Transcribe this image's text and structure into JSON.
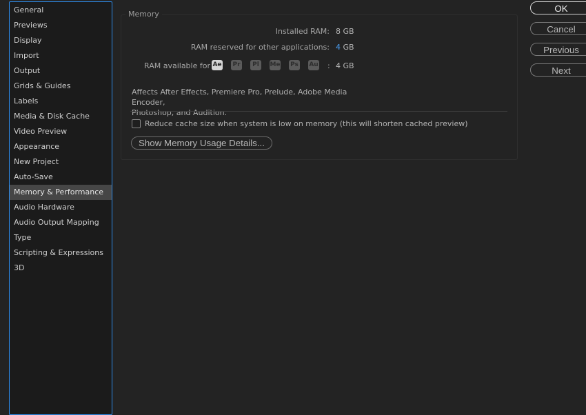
{
  "sidebar": {
    "items": [
      {
        "label": "General"
      },
      {
        "label": "Previews"
      },
      {
        "label": "Display"
      },
      {
        "label": "Import"
      },
      {
        "label": "Output"
      },
      {
        "label": "Grids & Guides"
      },
      {
        "label": "Labels"
      },
      {
        "label": "Media & Disk Cache"
      },
      {
        "label": "Video Preview"
      },
      {
        "label": "Appearance"
      },
      {
        "label": "New Project"
      },
      {
        "label": "Auto-Save"
      },
      {
        "label": "Memory & Performance"
      },
      {
        "label": "Audio Hardware"
      },
      {
        "label": "Audio Output Mapping"
      },
      {
        "label": "Type"
      },
      {
        "label": "Scripting & Expressions"
      },
      {
        "label": "3D"
      }
    ],
    "selected": "Memory & Performance"
  },
  "memory": {
    "title": "Memory",
    "installed_label": "Installed RAM:",
    "installed_value": "8 GB",
    "reserved_label": "RAM reserved for other applications:",
    "reserved_amount": "4",
    "reserved_unit": "GB",
    "available_label": "RAM available for",
    "apps": [
      "Ae",
      "Pr",
      "Pl",
      "Me",
      "Ps",
      "Au"
    ],
    "available_sep": ":",
    "available_value": "4 GB",
    "affects_line1": "Affects After Effects, Premiere Pro, Prelude, Adobe Media Encoder,",
    "affects_line2": "Photoshop, and Audition.",
    "reduce_cache_label": "Reduce cache size when system is low on memory (this will shorten cached preview)",
    "reduce_cache_checked": false,
    "details_button": "Show Memory Usage Details..."
  },
  "buttons": {
    "ok": "OK",
    "cancel": "Cancel",
    "previous": "Previous",
    "next": "Next"
  },
  "colors": {
    "accent": "#4a9ff5",
    "sidebar_focus": "#2d8ceb",
    "selected_item": "#464646"
  }
}
